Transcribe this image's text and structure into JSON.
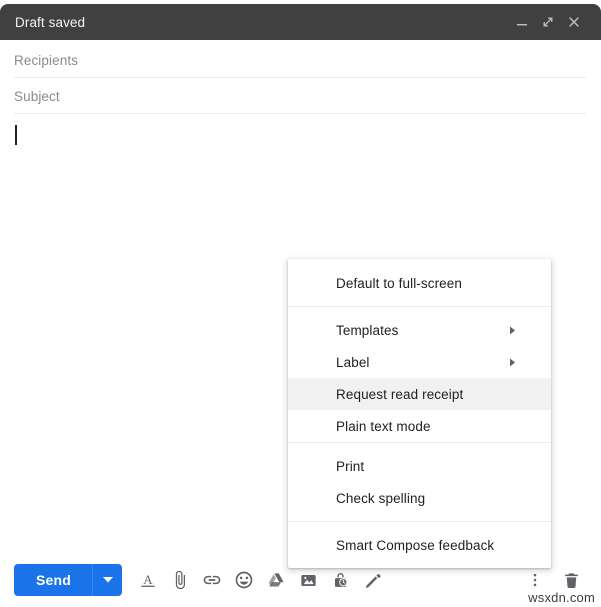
{
  "window": {
    "title": "Draft saved",
    "controls": [
      {
        "name": "minimize-button",
        "icon": "minimize-icon"
      },
      {
        "name": "expand-button",
        "icon": "expand-icon"
      },
      {
        "name": "close-button",
        "icon": "close-icon"
      }
    ],
    "header_color": "#404040"
  },
  "fields": {
    "recipients_placeholder": "Recipients",
    "subject_placeholder": "Subject",
    "recipients_value": "",
    "subject_value": "",
    "body_value": ""
  },
  "menu": {
    "groups": [
      {
        "items": [
          {
            "label": "Default to full-screen",
            "name": "menu-item-default-to-full-screen",
            "submenu": false,
            "highlighted": false
          }
        ]
      },
      {
        "items": [
          {
            "label": "Templates",
            "name": "menu-item-templates",
            "submenu": true,
            "highlighted": false
          },
          {
            "label": "Label",
            "name": "menu-item-label",
            "submenu": true,
            "highlighted": false
          },
          {
            "label": "Request read receipt",
            "name": "menu-item-request-read-receipt",
            "submenu": false,
            "highlighted": true
          },
          {
            "label": "Plain text mode",
            "name": "menu-item-plain-text-mode",
            "submenu": false,
            "highlighted": false
          }
        ]
      },
      {
        "items": [
          {
            "label": "Print",
            "name": "menu-item-print",
            "submenu": false,
            "highlighted": false
          },
          {
            "label": "Check spelling",
            "name": "menu-item-check-spelling",
            "submenu": false,
            "highlighted": false
          }
        ]
      },
      {
        "items": [
          {
            "label": "Smart Compose feedback",
            "name": "menu-item-smart-compose-feedback",
            "submenu": false,
            "highlighted": false
          }
        ]
      }
    ],
    "highlight_color": "#f1f1f1"
  },
  "toolbar": {
    "send_label": "Send",
    "send_color": "#1a73e8",
    "left_icons": [
      {
        "name": "formatting-options-icon",
        "label": "Formatting options"
      },
      {
        "name": "attach-file-icon",
        "label": "Attach files"
      },
      {
        "name": "insert-link-icon",
        "label": "Insert link"
      },
      {
        "name": "insert-emoji-icon",
        "label": "Insert emoji"
      },
      {
        "name": "insert-drive-file-icon",
        "label": "Insert files using Drive"
      },
      {
        "name": "insert-photo-icon",
        "label": "Insert photo"
      },
      {
        "name": "confidential-mode-icon",
        "label": "Toggle confidential mode"
      },
      {
        "name": "insert-signature-icon",
        "label": "Insert signature"
      }
    ],
    "right_icons": [
      {
        "name": "more-options-icon",
        "label": "More options"
      },
      {
        "name": "discard-draft-icon",
        "label": "Discard draft"
      }
    ]
  },
  "watermark": {
    "text": "wsxdn.com"
  }
}
